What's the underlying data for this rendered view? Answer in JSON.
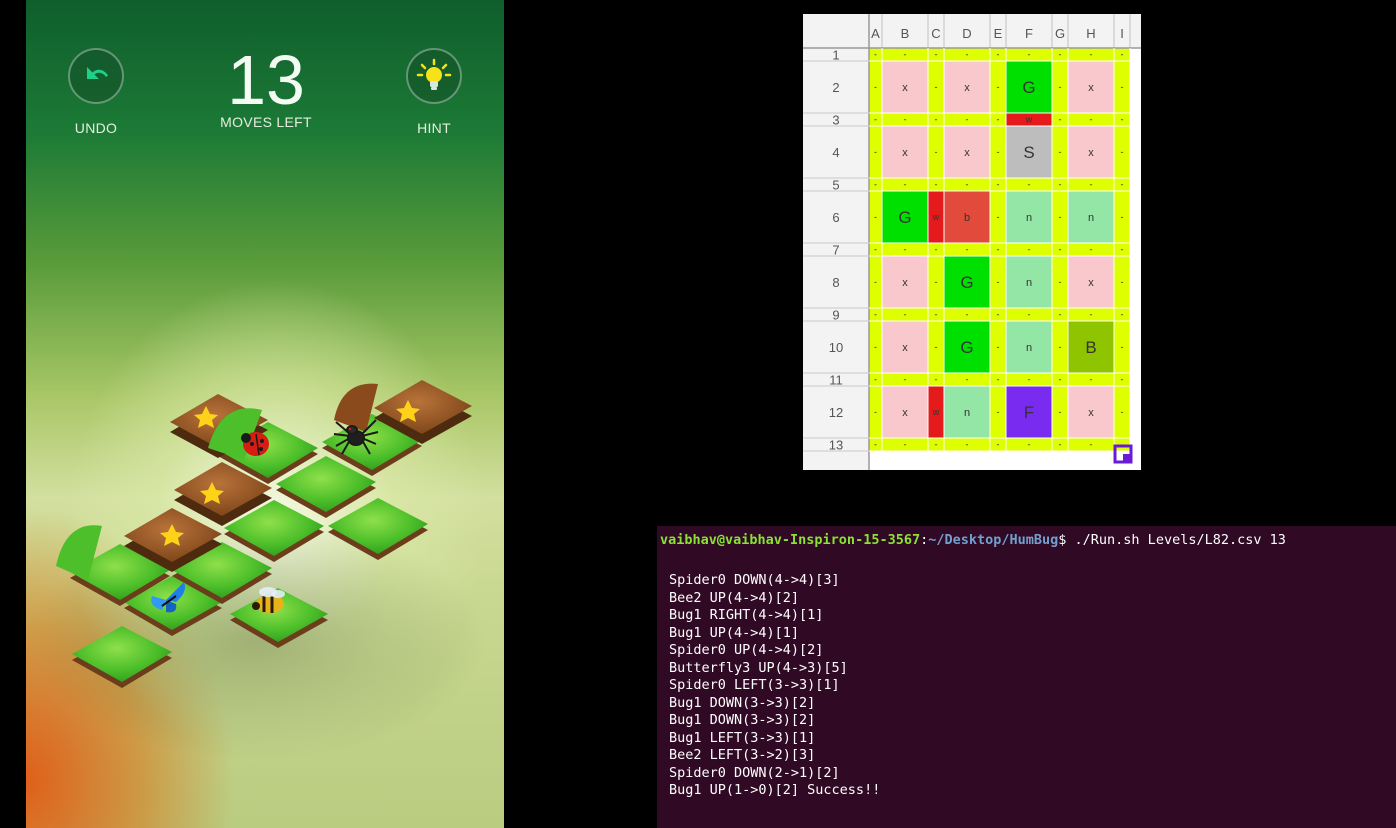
{
  "game": {
    "undo_label": "UNDO",
    "moves_count": "13",
    "moves_label": "MOVES LEFT",
    "hint_label": "HINT"
  },
  "sheet": {
    "columns": [
      "A",
      "B",
      "C",
      "D",
      "E",
      "F",
      "G",
      "H",
      "I"
    ],
    "rows": [
      "1",
      "2",
      "3",
      "4",
      "5",
      "6",
      "7",
      "8",
      "9",
      "10",
      "11",
      "12",
      "13"
    ],
    "cells": [
      {
        "row": 2,
        "col": "B",
        "text": "x",
        "color": "#f8c8cc"
      },
      {
        "row": 2,
        "col": "D",
        "text": "x",
        "color": "#f8c8cc"
      },
      {
        "row": 2,
        "col": "F",
        "text": "G",
        "color": "#00e000"
      },
      {
        "row": 2,
        "col": "H",
        "text": "x",
        "color": "#f8c8cc"
      },
      {
        "row": 3,
        "col": "F",
        "text": "w",
        "color": "#e51b1b"
      },
      {
        "row": 4,
        "col": "B",
        "text": "x",
        "color": "#f8c8cc"
      },
      {
        "row": 4,
        "col": "D",
        "text": "x",
        "color": "#f8c8cc"
      },
      {
        "row": 4,
        "col": "F",
        "text": "S",
        "color": "#bdbdbd"
      },
      {
        "row": 4,
        "col": "H",
        "text": "x",
        "color": "#f8c8cc"
      },
      {
        "row": 6,
        "col": "B",
        "text": "G",
        "color": "#00e000"
      },
      {
        "row": 6,
        "col": "C",
        "text": "w",
        "color": "#e51b1b"
      },
      {
        "row": 6,
        "col": "D",
        "text": "b",
        "color": "#e24a3c"
      },
      {
        "row": 6,
        "col": "F",
        "text": "n",
        "color": "#93e6a6"
      },
      {
        "row": 6,
        "col": "H",
        "text": "n",
        "color": "#93e6a6"
      },
      {
        "row": 8,
        "col": "B",
        "text": "x",
        "color": "#f8c8cc"
      },
      {
        "row": 8,
        "col": "D",
        "text": "G",
        "color": "#00e000"
      },
      {
        "row": 8,
        "col": "F",
        "text": "n",
        "color": "#93e6a6"
      },
      {
        "row": 8,
        "col": "H",
        "text": "x",
        "color": "#f8c8cc"
      },
      {
        "row": 10,
        "col": "B",
        "text": "x",
        "color": "#f8c8cc"
      },
      {
        "row": 10,
        "col": "D",
        "text": "G",
        "color": "#00e000"
      },
      {
        "row": 10,
        "col": "F",
        "text": "n",
        "color": "#93e6a6"
      },
      {
        "row": 10,
        "col": "H",
        "text": "B",
        "color": "#8fc400"
      },
      {
        "row": 12,
        "col": "B",
        "text": "x",
        "color": "#f8c8cc"
      },
      {
        "row": 12,
        "col": "C",
        "text": "w",
        "color": "#e51b1b"
      },
      {
        "row": 12,
        "col": "D",
        "text": "n",
        "color": "#93e6a6"
      },
      {
        "row": 12,
        "col": "F",
        "text": "F",
        "color": "#7a2bf0"
      },
      {
        "row": 12,
        "col": "H",
        "text": "x",
        "color": "#f8c8cc"
      }
    ],
    "filler_text": "-",
    "filler_color": "#ddff00",
    "header_color": "#f3f3f3"
  },
  "terminal": {
    "user_host": "vaibhav@vaibhav-Inspiron-15-3567",
    "path": "~/Desktop/HumBug",
    "command": "$ ./Run.sh Levels/L82.csv 13",
    "lines": [
      "Spider0 DOWN(4->4)[3]",
      "Bee2 UP(4->4)[2]",
      "Bug1 RIGHT(4->4)[1]",
      "Bug1 UP(4->4)[1]",
      "Spider0 UP(4->4)[2]",
      "Butterfly3 UP(4->3)[5]",
      "Spider0 LEFT(3->3)[1]",
      "Bug1 DOWN(3->3)[2]",
      "Bug1 DOWN(3->3)[2]",
      "Bug1 LEFT(3->3)[1]",
      "Bee2 LEFT(3->2)[3]",
      "Spider0 DOWN(2->1)[2]",
      "Bug1 UP(1->0)[2] Success!!"
    ]
  }
}
